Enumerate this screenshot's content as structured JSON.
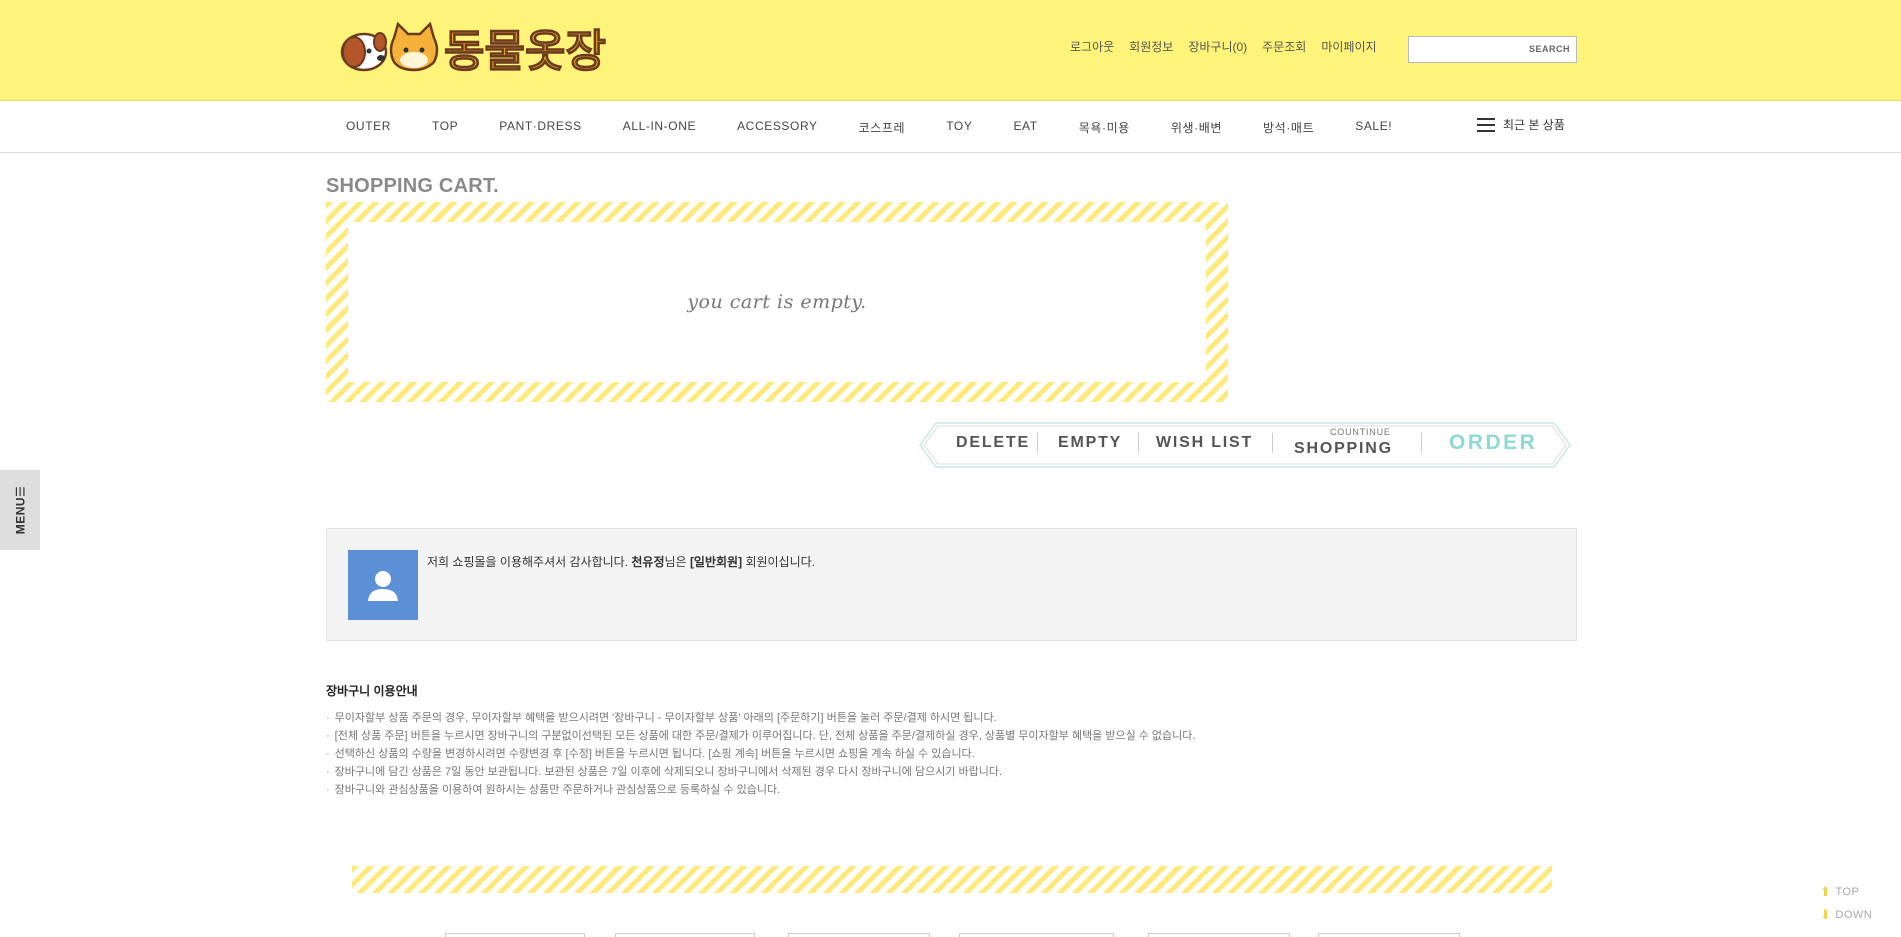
{
  "logo": {
    "text": "동물옷장"
  },
  "header": {
    "links": [
      "로그아웃",
      "회원정보",
      "장바구니(0)",
      "주문조회",
      "마이페이지"
    ],
    "search_button": "SEARCH"
  },
  "nav": {
    "items": [
      "OUTER",
      "TOP",
      "PANT·DRESS",
      "ALL-IN-ONE",
      "ACCESSORY",
      "코스프레",
      "TOY",
      "EAT",
      "목욕·미용",
      "위생·배변",
      "방석·매트",
      "SALE!"
    ],
    "recent_label": "최근 본 상품"
  },
  "side_menu": {
    "label": "MENU☰"
  },
  "cart": {
    "title": "SHOPPING CART.",
    "empty_message": "you cart is empty."
  },
  "actions": {
    "delete": "DELETE",
    "empty": "EMPTY",
    "wishlist": "WISH LIST",
    "continue_small": "COUNTINUE",
    "shopping": "SHOPPING",
    "order": "ORDER"
  },
  "member": {
    "text_prefix": "저희 쇼핑몰을 이용해주셔서 감사합니다.",
    "name": "천유정",
    "text_mid": "님은",
    "grade": "[일반회원]",
    "text_suffix": "회원이십니다."
  },
  "guide": {
    "title": "장바구니 이용안내",
    "items": [
      "무이자할부 상품 주문의 경우, 무이자할부 혜택을 받으시려면 '장바구니 - 무이자할부 상품' 아래의 [주문하기] 버튼을 눌러 주문/결제 하시면 됩니다.",
      "[전체 상품 주문] 버튼을 누르시면 장바구니의 구분없이선택된 모든 상품에 대한 주문/결제가 이루어집니다. 단, 전체 상품을 주문/결제하실 경우, 상품별 무이자할부 혜택을 받으실 수 없습니다.",
      "선택하신 상품의 수량을 변경하시려면 수량변경 후 [수정] 버튼을 누르시면 됩니다. [쇼핑 계속] 버튼을 누르시면 쇼핑을 계속 하실 수 있습니다.",
      "장바구니에 담긴 상품은 7일 동안 보관됩니다. 보관된 상품은 7일 이후에 삭제되오니 장바구니에서 삭제된 경우 다시 장바구니에 담으시기 바랍니다.",
      "장바구니와 관심상품을 이용하여 원하시는 상품만 주문하거나 관심상품으로 등록하실 수 있습니다."
    ]
  },
  "scroll": {
    "top": "TOP",
    "down": "DOWN"
  },
  "colors": {
    "header_bg": "#fff47a",
    "stripe": "#ffe97a",
    "order": "#8fd8d4",
    "avatar": "#5b8fd6"
  }
}
